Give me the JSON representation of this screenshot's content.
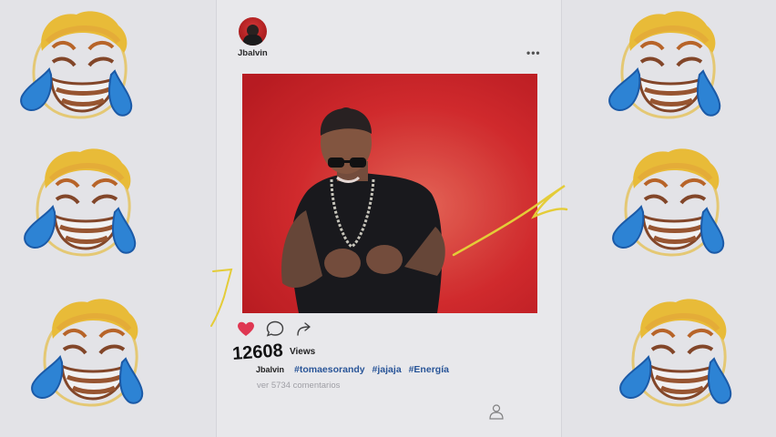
{
  "post": {
    "username": "Jbalvin",
    "more_label": "•••",
    "views_count": "12608",
    "views_label": "Views",
    "caption_user": "Jbalvin",
    "hashtags": [
      "#tomaesorandy",
      "#jajaja",
      "#Energía"
    ],
    "comments_link": "ver 5734 comentarios"
  },
  "icons": {
    "like": "heart-icon",
    "comment": "comment-bubble-icon",
    "share": "share-arrow-icon",
    "profile": "user-profile-icon",
    "options": "more-options-icon",
    "background_emoji": "face-with-tears-of-joy-icon"
  },
  "colors": {
    "like": "#ec3a56",
    "photo_background": "#d8282c",
    "hashtag": "#2b5aa0",
    "scribble": "#f2d83a",
    "emoji_face": "#f6c63a",
    "emoji_tears": "#2f8be0"
  }
}
